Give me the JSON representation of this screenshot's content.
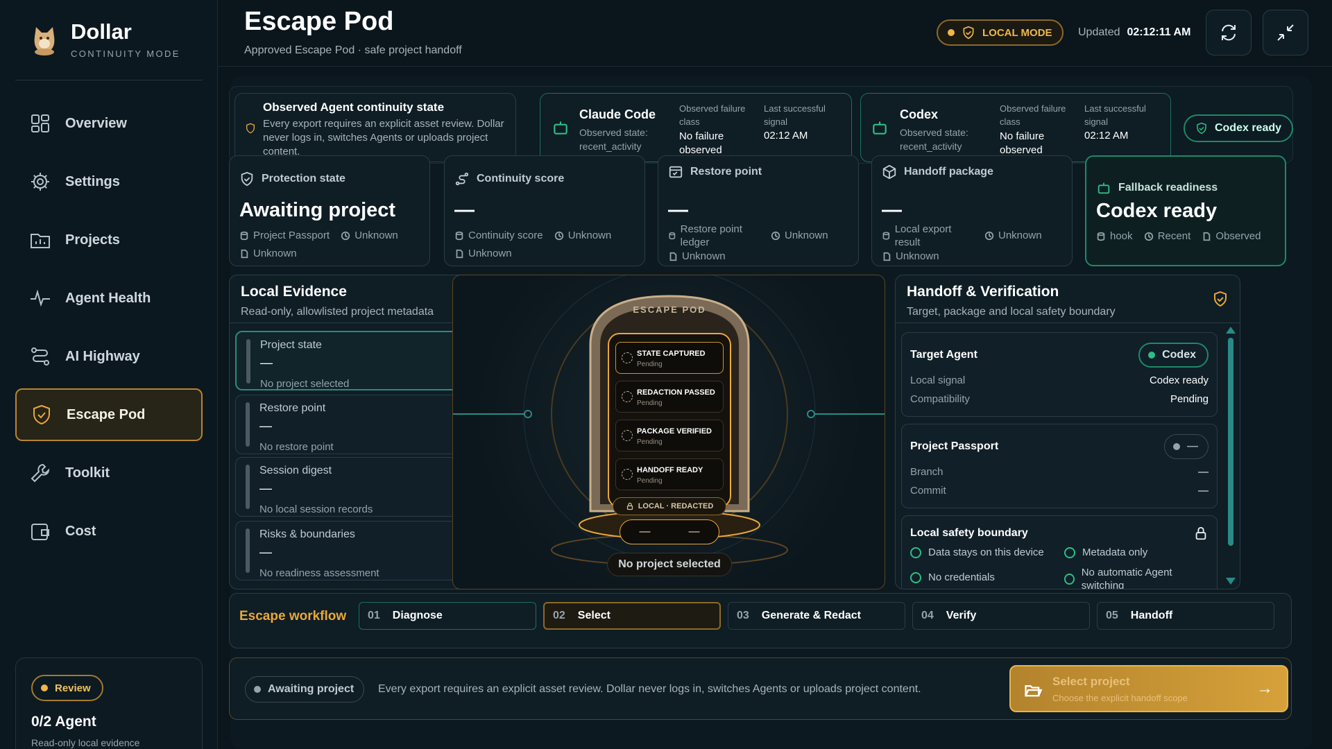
{
  "app": {
    "name": "Dollar",
    "mode_label": "CONTINUITY MODE"
  },
  "sidebar": {
    "items": [
      {
        "label": "Overview",
        "icon": "grid-icon"
      },
      {
        "label": "Settings",
        "icon": "gear-icon"
      },
      {
        "label": "Projects",
        "icon": "folder-chart-icon"
      },
      {
        "label": "Agent Health",
        "icon": "pulse-icon"
      },
      {
        "label": "AI Highway",
        "icon": "route-icon"
      },
      {
        "label": "Escape Pod",
        "icon": "shield-icon",
        "active": true
      },
      {
        "label": "Toolkit",
        "icon": "wrench-icon"
      },
      {
        "label": "Cost",
        "icon": "wallet-icon"
      }
    ],
    "review": {
      "badge": "Review",
      "title": "0/2 Agent",
      "subtitle": "Read-only local evidence"
    }
  },
  "header": {
    "title": "Escape Pod",
    "subtitle": "Approved Escape Pod · safe project handoff",
    "mode": "LOCAL MODE",
    "updated_label": "Updated",
    "updated_time": "02:12:11 AM"
  },
  "observed": {
    "title": "Observed Agent continuity state",
    "text": "Every export requires an explicit asset review. Dollar never logs in, switches Agents or uploads project content."
  },
  "agents": [
    {
      "name": "Claude Code",
      "state_label": "Observed state:",
      "state": "recent_activity",
      "failure_label": "Observed failure class",
      "failure": "No failure observed",
      "success_label": "Last successful signal",
      "success": "02:12 AM"
    },
    {
      "name": "Codex",
      "state_label": "Observed state:",
      "state": "recent_activity",
      "failure_label": "Observed failure class",
      "failure": "No failure observed",
      "success_label": "Last successful signal",
      "success": "02:12 AM"
    }
  ],
  "codex_ready_pill": "Codex ready",
  "stats": [
    {
      "title": "Protection state",
      "value": "Awaiting project",
      "m1": "Project Passport",
      "m2": "Unknown",
      "m3": "Unknown"
    },
    {
      "title": "Continuity score",
      "value": "—",
      "m1": "Continuity score",
      "m2": "Unknown",
      "m3": "Unknown"
    },
    {
      "title": "Restore point",
      "value": "—",
      "m1": "Restore point ledger",
      "m2": "Unknown",
      "m3": "Unknown"
    },
    {
      "title": "Handoff package",
      "value": "—",
      "m1": "Local export result",
      "m2": "Unknown",
      "m3": "Unknown"
    },
    {
      "title": "Fallback readiness",
      "value": "Codex ready",
      "m1": "hook",
      "m2": "Recent",
      "m3": "Observed"
    }
  ],
  "evidence": {
    "title": "Local Evidence",
    "subtitle": "Read-only, allowlisted project metadata",
    "items": [
      {
        "title": "Project state",
        "value": "—",
        "sub": "No project selected"
      },
      {
        "title": "Restore point",
        "value": "—",
        "sub": "No restore point"
      },
      {
        "title": "Session digest",
        "value": "—",
        "sub": "No local session records"
      },
      {
        "title": "Risks & boundaries",
        "value": "—",
        "sub": "No readiness assessment"
      }
    ]
  },
  "pod": {
    "header": "ESCAPE POD",
    "steps": [
      {
        "title": "STATE CAPTURED",
        "status": "Pending"
      },
      {
        "title": "REDACTION PASSED",
        "status": "Pending"
      },
      {
        "title": "PACKAGE VERIFIED",
        "status": "Pending"
      },
      {
        "title": "HANDOFF READY",
        "status": "Pending"
      }
    ],
    "lock_label": "LOCAL · REDACTED",
    "left_dash": "—",
    "right_dash": "—",
    "caption": "No project selected"
  },
  "handoff": {
    "title": "Handoff & Verification",
    "subtitle": "Target, package and local safety boundary",
    "target": {
      "title": "Target Agent",
      "pill": "Codex",
      "rows": [
        {
          "k": "Local signal",
          "v": "Codex ready"
        },
        {
          "k": "Compatibility",
          "v": "Pending"
        }
      ]
    },
    "passport": {
      "title": "Project Passport",
      "pill": "—",
      "rows": [
        {
          "k": "Branch",
          "v": "—"
        },
        {
          "k": "Commit",
          "v": "—"
        }
      ]
    },
    "safety": {
      "title": "Local safety boundary",
      "items": [
        "Data stays on this device",
        "Metadata only",
        "No credentials",
        "No automatic Agent switching"
      ]
    }
  },
  "workflow": {
    "label": "Escape workflow",
    "steps": [
      {
        "n": "01",
        "label": "Diagnose"
      },
      {
        "n": "02",
        "label": "Select"
      },
      {
        "n": "03",
        "label": "Generate & Redact"
      },
      {
        "n": "04",
        "label": "Verify"
      },
      {
        "n": "05",
        "label": "Handoff"
      }
    ]
  },
  "footer": {
    "status": "Awaiting project",
    "message": "Every export requires an explicit asset review. Dollar never logs in, switches Agents or uploads project content.",
    "cta_title": "Select project",
    "cta_sub": "Choose the explicit handoff scope"
  },
  "colors": {
    "accent": "#e9a838",
    "teal": "#2a8a87",
    "green": "#2bbf84",
    "bg": "#0a151c"
  }
}
